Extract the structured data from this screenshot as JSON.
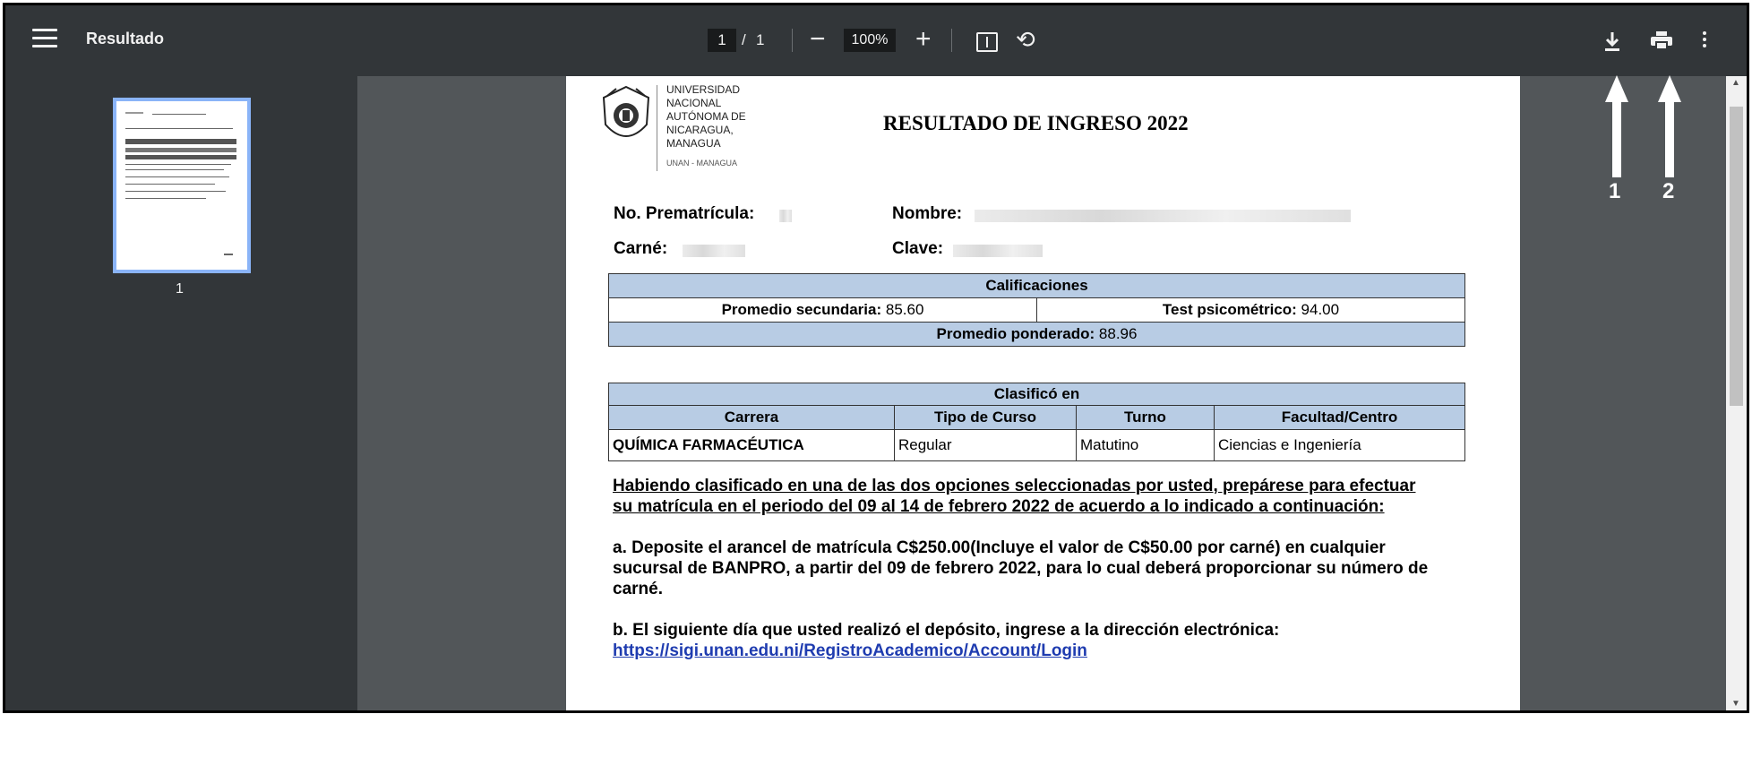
{
  "app": {
    "title": "Resultado"
  },
  "toolbar": {
    "page_current": "1",
    "page_separator": "/",
    "page_total": "1",
    "zoom_out": "−",
    "zoom_level": "100%",
    "zoom_in": "+"
  },
  "icons": {
    "menu": "hamburger-icon",
    "fit": "fit-page-icon",
    "rotate": "rotate-icon",
    "download": "download-icon",
    "print": "print-icon",
    "more": "more-vert-icon"
  },
  "sidebar": {
    "thumbnail_label": "1"
  },
  "annotations": {
    "arrow1": "1",
    "arrow2": "2"
  },
  "document": {
    "university_lines": [
      "UNIVERSIDAD",
      "NACIONAL",
      "AUTÓNOMA DE",
      "NICARAGUA,",
      "MANAGUA"
    ],
    "university_sub": "UNAN - MANAGUA",
    "heading": "RESULTADO DE INGRESO 2022",
    "prematricula_label": "No. Prematrícula:",
    "nombre_label": "Nombre:",
    "carne_label": "Carné:",
    "clave_label": "Clave:",
    "calificaciones": {
      "header": "Calificaciones",
      "promedio_secundaria_label": "Promedio secundaria:",
      "promedio_secundaria_value": "85.60",
      "test_label": "Test psicométrico:",
      "test_value": "94.00",
      "ponderado_label": "Promedio ponderado:",
      "ponderado_value": "88.96"
    },
    "clasifico": {
      "header": "Clasificó en",
      "columns": [
        "Carrera",
        "Tipo de Curso",
        "Turno",
        "Facultad/Centro"
      ],
      "row": [
        "QUÍMICA FARMACÉUTICA",
        "Regular",
        "Matutino",
        "Ciencias e Ingeniería"
      ]
    },
    "notice_intro": "Habiendo clasificado en una de las dos opciones seleccionadas por usted, prepárese para efectuar su matrícula en el periodo del 09 al 14 de febrero 2022 de acuerdo a lo indicado a continuación:",
    "step_a": "a. Deposite el arancel de matrícula C$250.00(Incluye el valor de C$50.00 por carné) en cualquier sucursal de BANPRO, a partir del 09 de febrero 2022, para lo cual deberá proporcionar su número de carné.",
    "step_b": "b. El siguiente día que usted realizó el depósito, ingrese a la dirección electrónica:",
    "link": "https://sigi.unan.edu.ni/RegistroAcademico/Account/Login"
  }
}
